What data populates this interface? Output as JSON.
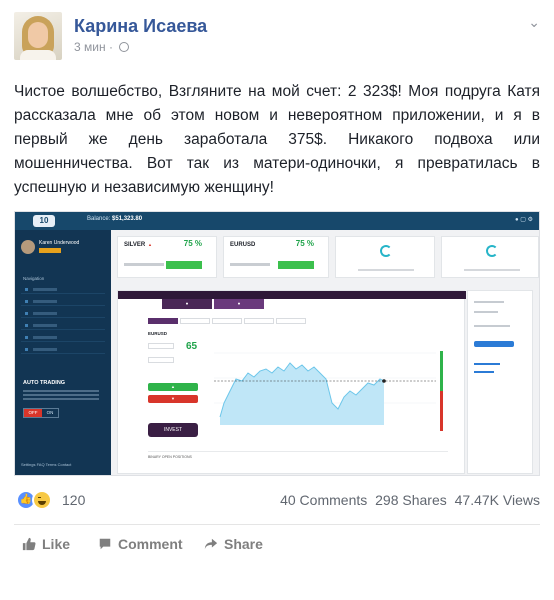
{
  "post": {
    "author": "Карина Исаева",
    "time": "3 мин",
    "separator": "·",
    "text": "Чистое волшебство, Взгляните на мой счет: 2 323$! Моя подруга Катя рассказала мне об этом новом и невероятном приложении, и я в первый же день заработала 375$. Никакого подвоха или мошенничества. Вот так из матери-одиночки, я превратилась в успешную и независимую женщину!"
  },
  "screenshot": {
    "balance_label": "Balance:",
    "balance_value": "$51,323.80",
    "user_name": "Karen Underwood",
    "nav_title": "Navigation",
    "auto_trading": "AUTO TRADING",
    "toggle_off": "OFF",
    "toggle_on": "ON",
    "footer": "Settings  FAQ  Terms  Contact",
    "cards": [
      {
        "title": "SILVER",
        "pct": "75 %"
      },
      {
        "title": "EURUSD",
        "pct": "75 %"
      }
    ],
    "asset": "EURUSD",
    "payout": "65",
    "invest_label": "INVEST",
    "positions_label": "BINARY OPEN POSITIONS"
  },
  "footer": {
    "reactions_count": "120",
    "comments": "40 Comments",
    "shares": "298 Shares",
    "views": "47.47K Views",
    "like": "Like",
    "comment": "Comment",
    "share": "Share"
  },
  "icons": {
    "like_reaction": "thumbs-up-icon",
    "haha_reaction": "laughing-face-icon",
    "privacy": "globe-icon",
    "options": "chevron-down-icon"
  }
}
